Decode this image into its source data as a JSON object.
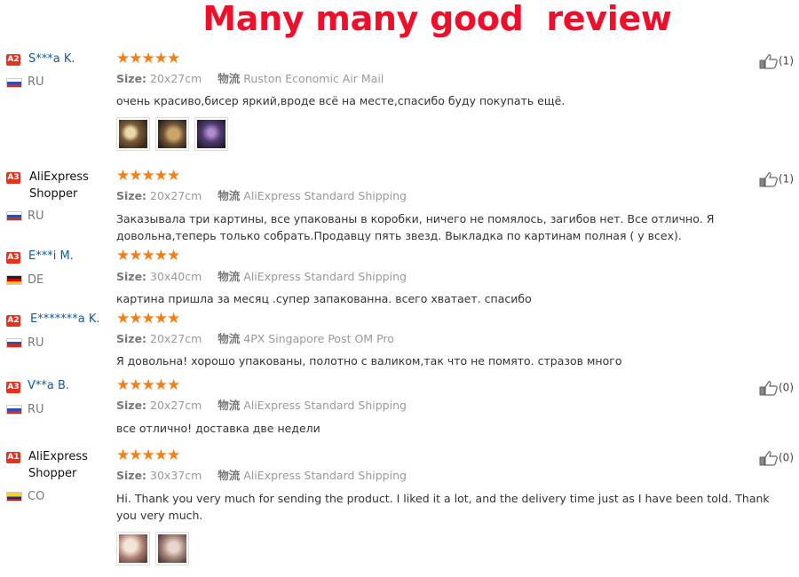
{
  "banner": {
    "title": "Many many good  review"
  },
  "labels": {
    "size": "Size:",
    "shipping": "物流"
  },
  "colors": {
    "banner": "#ee0f2a",
    "badge": "#e4331c",
    "star": "#f57f17",
    "username": "#0e5ca8"
  },
  "reviews": [
    {
      "level": "A2",
      "name": "S***a K.",
      "country": "RU",
      "rating": 5,
      "stars": "★★★★★",
      "size": "20x27cm",
      "shipping": "Ruston Economic Air Mail",
      "text": "очень красиво,бисер яркий,вроде всё на месте,спасибо буду покупать ещё.",
      "helpful": "(1)",
      "photos": 3
    },
    {
      "level": "A3",
      "name": "AliExpress Shopper",
      "country": "RU",
      "rating": 5,
      "stars": "★★★★★",
      "size": "20x27cm",
      "shipping": "AliExpress Standard Shipping",
      "text": "Заказывала три картины, все упакованы в коробки, ничего не помялось, загибов нет. Все отлично. Я довольна,теперь только собрать.Продавцу пять звезд. Выкладка по картинам полная ( у всех).",
      "helpful": "(1)",
      "photos": 0
    },
    {
      "level": "A3",
      "name": "E***i M.",
      "country": "DE",
      "rating": 5,
      "stars": "★★★★★",
      "size": "30x40cm",
      "shipping": "AliExpress Standard Shipping",
      "text": "картина пришла за месяц .супер запакованна. всего хватает. спасибо",
      "helpful": "",
      "photos": 0
    },
    {
      "level": "A2",
      "name": "E*******a K.",
      "country": "RU",
      "rating": 5,
      "stars": "★★★★★",
      "size": "20x27cm",
      "shipping": "4PX Singapore Post OM Pro",
      "text": "Я довольна! хорошо упакованы, полотно с валиком,так что не помято. стразов много",
      "helpful": "",
      "photos": 0
    },
    {
      "level": "A3",
      "name": "V**a B.",
      "country": "RU",
      "rating": 5,
      "stars": "★★★★★",
      "size": "20x27cm",
      "shipping": "AliExpress Standard Shipping",
      "text": "все отлично! доставка две недели",
      "helpful": "(0)",
      "photos": 0
    },
    {
      "level": "A1",
      "name": "AliExpress Shopper",
      "country": "CO",
      "rating": 5,
      "stars": "★★★★★",
      "size": "30x37cm",
      "shipping": "AliExpress Standard Shipping",
      "text": "Hi. Thank you very much for sending the product. I liked it a lot, and the delivery time just as I have been told. Thank you very much.",
      "helpful": "(0)",
      "photos": 2
    }
  ]
}
